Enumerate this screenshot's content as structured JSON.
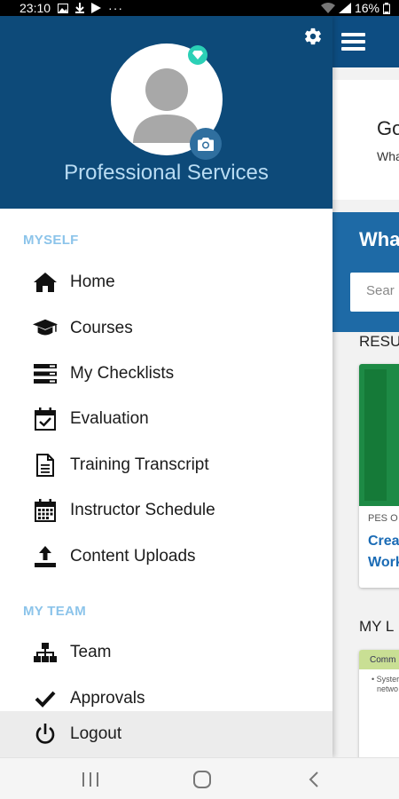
{
  "status_bar": {
    "time": "23:10",
    "battery": "16%"
  },
  "background_app": {
    "greeting": "Go",
    "greeting_sub": "Wha",
    "search_title": "Wha",
    "search_placeholder": "Sear",
    "results_heading": "RESU",
    "card_caption": "PES O",
    "card_title_line1": "Crea",
    "card_title_line2": "Work",
    "my_heading": "MY L",
    "card2_bar": "Comm",
    "card2_line1": "• Syster",
    "card2_line2": "netwo"
  },
  "drawer": {
    "profile_name": "Professional Services",
    "sections": [
      {
        "label": "MYSELF",
        "items": [
          {
            "label": "Home",
            "icon": "home-icon"
          },
          {
            "label": "Courses",
            "icon": "graduation-cap-icon"
          },
          {
            "label": "My Checklists",
            "icon": "checklist-icon"
          },
          {
            "label": "Evaluation",
            "icon": "calendar-check-icon"
          },
          {
            "label": "Training Transcript",
            "icon": "document-icon"
          },
          {
            "label": "Instructor Schedule",
            "icon": "calendar-icon"
          },
          {
            "label": "Content Uploads",
            "icon": "upload-icon"
          }
        ]
      },
      {
        "label": "MY TEAM",
        "items": [
          {
            "label": "Team",
            "icon": "org-chart-icon"
          },
          {
            "label": "Approvals",
            "icon": "checkmark-icon"
          }
        ]
      }
    ],
    "logout_label": "Logout"
  },
  "colors": {
    "header": "#0d4a79",
    "section_label": "#8cc4ea",
    "accent_badge": "#2bd0b6",
    "profile_name": "#b9dcf3"
  }
}
